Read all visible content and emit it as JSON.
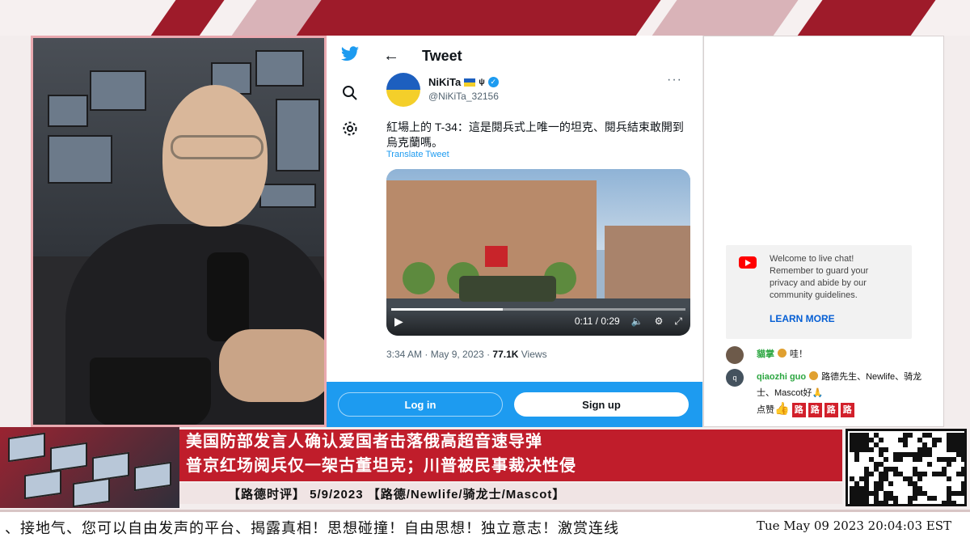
{
  "twitter": {
    "header_title": "Tweet",
    "user": {
      "display_name": "NiKiTa",
      "handle": "@NiKiTa_32156"
    },
    "tweet_text": "紅場上的 T-34：這是閱兵式上唯一的坦克、閱兵結束敢開到烏克蘭嗎。",
    "translate_link": "Translate Tweet",
    "video": {
      "current_time": "0:11",
      "duration": "0:29",
      "progress_fraction": 0.38
    },
    "timestamp": "3:34 AM · May 9, 2023 · ",
    "views_count": "77.1K",
    "views_label": " Views",
    "login_label": "Log in",
    "signup_label": "Sign up"
  },
  "chat": {
    "welcome_text": "Welcome to live chat! Remember to guard your privacy and abide by our community guidelines.",
    "learn_more": "LEARN MORE",
    "messages": [
      {
        "author": "貓掌",
        "text": "哇！"
      },
      {
        "author": "qiaozhi guo",
        "text": "路德先生、Newlife、骑龙士、Mascot好",
        "extra_prefix": "点赞",
        "blocks": [
          "路",
          "路",
          "路",
          "路"
        ]
      }
    ]
  },
  "broadcast": {
    "headline_line1": "美国防部发言人确认爱国者击落俄高超音速导弹",
    "headline_line2": "普京红场阅兵仅一架古董坦克；川普被民事裁决性侵",
    "subline": "【路德时评】 5/9/2023 【路德/Newlife/骑龙士/Mascot】",
    "ticker": "、接地气、您可以自由发声的平台、揭露真相！思想碰撞！自由思想！独立意志！激赏连线",
    "clock": "Tue May 09 2023 20:04:03 EST"
  },
  "colors": {
    "twitter_blue": "#1d9bf0",
    "headline_red": "#c01d2b",
    "youtube_red": "#ff0000",
    "chat_author_green": "#2ba640"
  },
  "icons": [
    "twitter-bird-icon",
    "search-icon",
    "gear-icon",
    "back-arrow-icon",
    "verified-icon",
    "more-icon",
    "play-icon",
    "volume-icon",
    "settings-icon",
    "fullscreen-icon",
    "youtube-icon",
    "thumbs-up-icon",
    "pray-icon"
  ]
}
